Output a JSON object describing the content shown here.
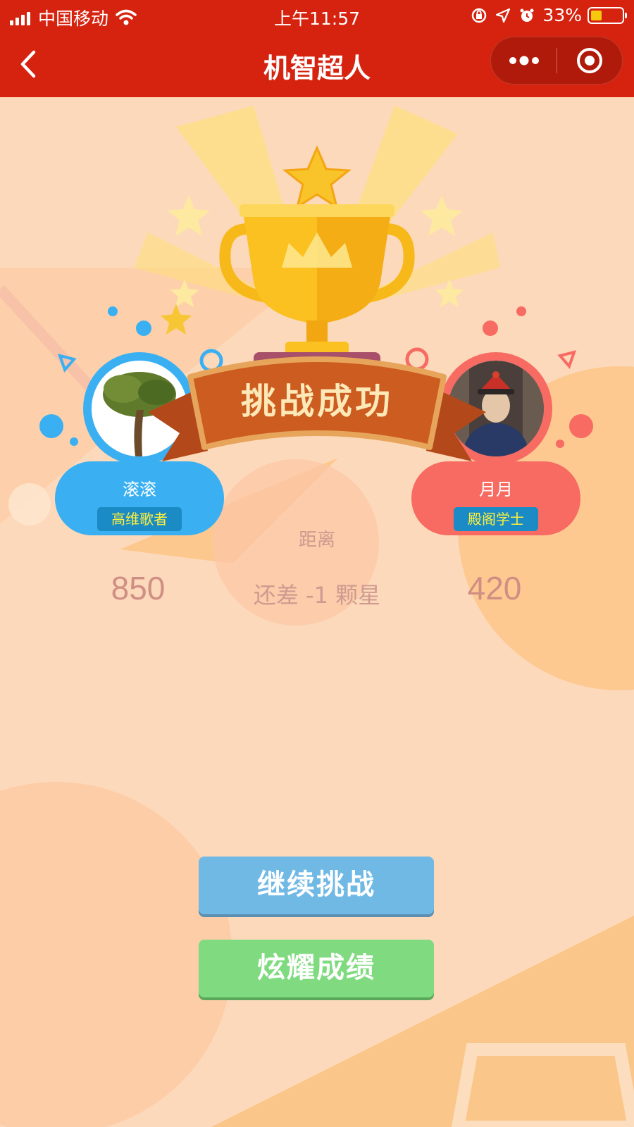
{
  "status_bar": {
    "carrier": "中国移动",
    "time": "上午11:57",
    "battery_percent": "33%"
  },
  "nav": {
    "title": "机智超人"
  },
  "banner": {
    "text": "挑战成功"
  },
  "players": {
    "left": {
      "name": "滚滚",
      "title": "高维歌者",
      "score": "850"
    },
    "right": {
      "name": "月月",
      "title": "殿阁学士",
      "score": "420"
    }
  },
  "result": {
    "distance_label": "距离",
    "distance_text": "还差 -1 颗星"
  },
  "buttons": {
    "continue_label": "继续挑战",
    "show_label": "炫耀成绩"
  },
  "colors": {
    "header_red": "#d6230f",
    "background_peach": "#fdd9bb",
    "player_blue": "#3ab0f2",
    "player_red": "#f76b62",
    "continue_blue": "#71b9e5",
    "show_green": "#80db80",
    "banner_orange": "#cc5c1f",
    "trophy_gold": "#f7b91a"
  },
  "icons": {
    "back": "chevron-left-icon",
    "more": "more-dots-icon",
    "close": "target-circle-icon",
    "trophy": "trophy-icon"
  }
}
